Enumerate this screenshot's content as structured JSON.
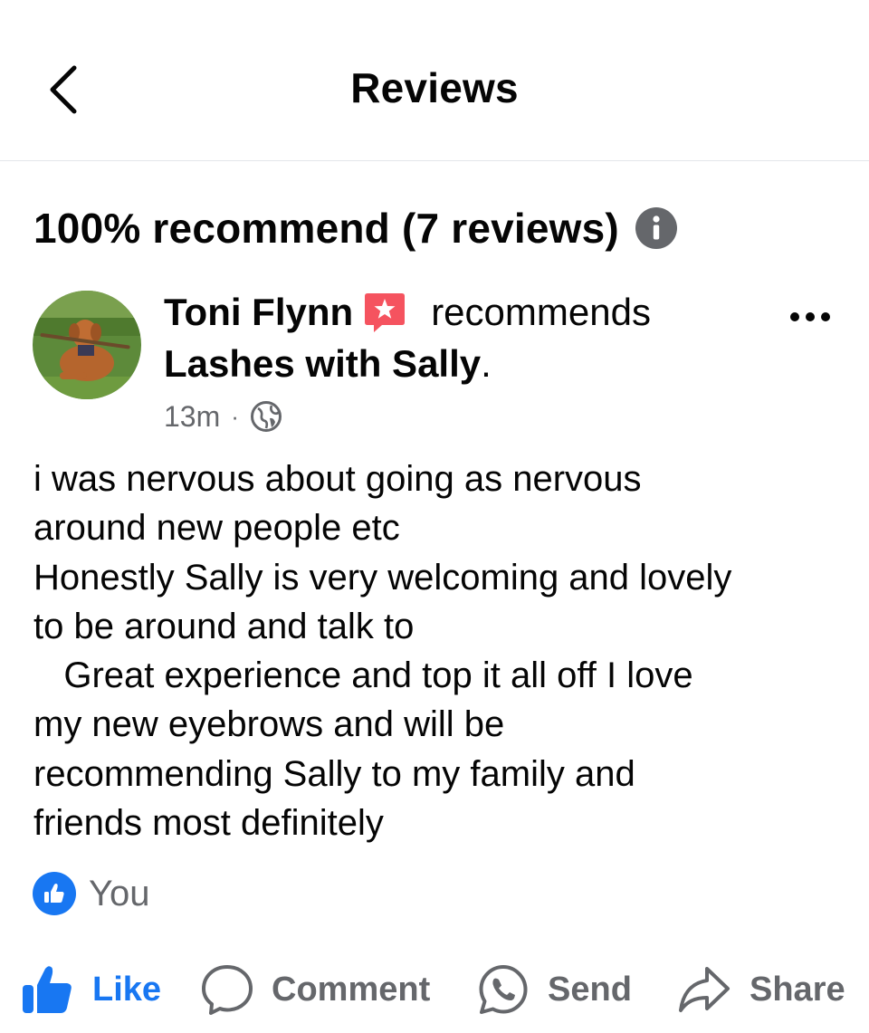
{
  "header": {
    "title": "Reviews",
    "back_icon": "chevron-left-icon"
  },
  "summary": {
    "text": "100% recommend (7 reviews)",
    "info_icon": "info-icon"
  },
  "review": {
    "author": "Toni Flynn",
    "badge_icon": "star-badge-icon",
    "verb": "recommends",
    "business": "Lashes with Sally",
    "business_suffix": ".",
    "time": "13m",
    "separator": "·",
    "privacy_icon": "globe-icon",
    "body": "i was nervous about going as nervous\naround new people etc\nHonestly Sally is very welcoming and lovely\nto be around and talk to\n   Great experience and top it all off I love\nmy new eyebrows and will be\nrecommending Sally to my family and\nfriends most definitely",
    "reactions": {
      "icon": "thumbs-up-icon",
      "text": "You"
    }
  },
  "actions": {
    "like": "Like",
    "comment": "Comment",
    "send": "Send",
    "share": "Share"
  },
  "colors": {
    "accent": "#1877f2",
    "secondary_text": "#65676b",
    "badge": "#f5535f"
  }
}
